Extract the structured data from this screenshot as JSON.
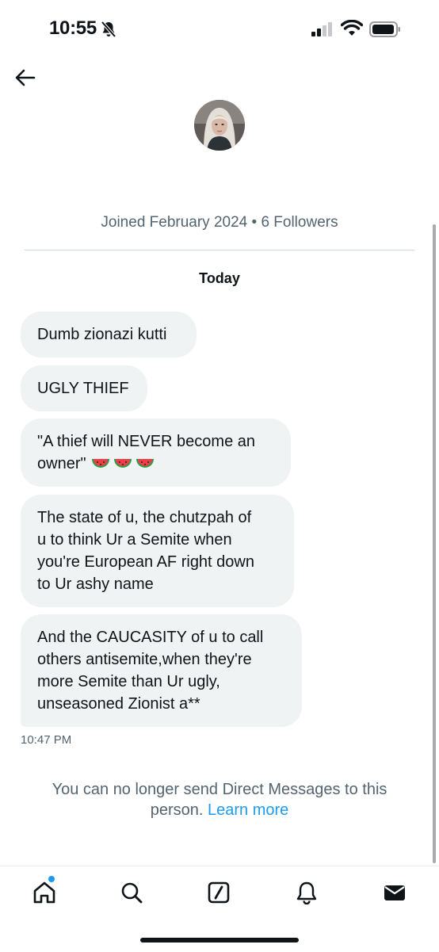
{
  "status_bar": {
    "time": "10:55",
    "icons": [
      "bell-off-icon",
      "signal-icon",
      "wifi-icon",
      "battery-icon"
    ]
  },
  "header": {
    "back_icon": "arrow-left-icon",
    "avatar_icon": "avatar"
  },
  "profile_info": {
    "joined_text": "Joined February 2024 • 6 Followers"
  },
  "conversation": {
    "date_label": "Today",
    "messages": [
      {
        "text": "Dumb zionazi kutti"
      },
      {
        "text": "UGLY THIEF"
      },
      {
        "line1": "\"A thief will NEVER become an",
        "line2": "owner\"",
        "emoji": [
          "watermelon-icon",
          "watermelon-icon",
          "watermelon-icon"
        ]
      },
      {
        "lines": [
          "The state of u, the chutzpah of",
          "u to think Ur a Semite when",
          "you're European AF right down",
          "to Ur ashy name"
        ]
      },
      {
        "lines": [
          "And the CAUCASITY of u to call",
          "others antisemite,when they're",
          "more Semite than Ur ugly,",
          "unseasoned Zionist a**"
        ]
      }
    ],
    "last_timestamp": "10:47 PM"
  },
  "notice": {
    "line1": "You can no longer send Direct Messages to this",
    "line2_prefix": "person.",
    "learn_more": "Learn more"
  },
  "tab_bar": {
    "tabs": [
      "home-icon",
      "search-icon",
      "grok-icon",
      "notifications-icon",
      "messages-icon"
    ],
    "accent_color": "#1d9bf0"
  }
}
